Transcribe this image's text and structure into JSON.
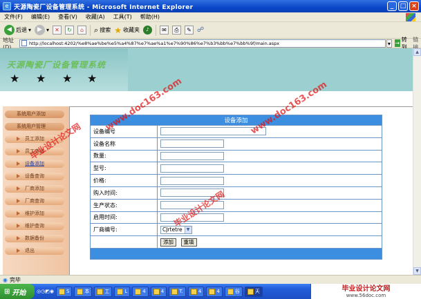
{
  "window": {
    "title": "天源陶瓷厂设备管理系统 - Microsoft Internet Explorer"
  },
  "menu": [
    "文件(F)",
    "编辑(E)",
    "查看(V)",
    "收藏(A)",
    "工具(T)",
    "帮助(H)"
  ],
  "toolbar": {
    "back": "后退",
    "search": "搜索",
    "favorites": "收藏夹"
  },
  "address": {
    "label": "地址(D)",
    "url": "http://localhost:4202/%e8%ae%be%e5%a4%87%e7%ae%a1%e7%90%86%e7%b3%bb%e7%bb%9f/main.aspx",
    "go": "转到",
    "links": "链接"
  },
  "banner": {
    "title": "天源陶瓷厂设备管理系统"
  },
  "sidebar": {
    "items": [
      "系统用户添加",
      "系统用户管理",
      "员工添加",
      "员工查询",
      "设备添加",
      "设备查询",
      "厂商添加",
      "厂商查询",
      "维护添加",
      "维护查询",
      "数据备份",
      "退出"
    ]
  },
  "form": {
    "title": "设备添加",
    "fields": [
      "设备编号",
      "设备名称",
      "数量:",
      "型号:",
      "价格:",
      "购入时间:",
      "生产状态:",
      "启用时间:",
      "厂商编号:"
    ],
    "vendor_selected": "CJrtetre",
    "add_button": "添加",
    "reset_button": "重填"
  },
  "watermarks": [
    "www.doc163.com",
    "毕业设计论文网"
  ],
  "status": {
    "text": "完毕"
  },
  "taskbar": {
    "start": "开始",
    "items": [
      "S",
      "本",
      "工",
      "L",
      "4",
      "4",
      "T.",
      "4",
      "4",
      "谷",
      "天"
    ]
  },
  "brand": {
    "line1": "毕业设计论文网",
    "line2": "www.56doc.com"
  }
}
